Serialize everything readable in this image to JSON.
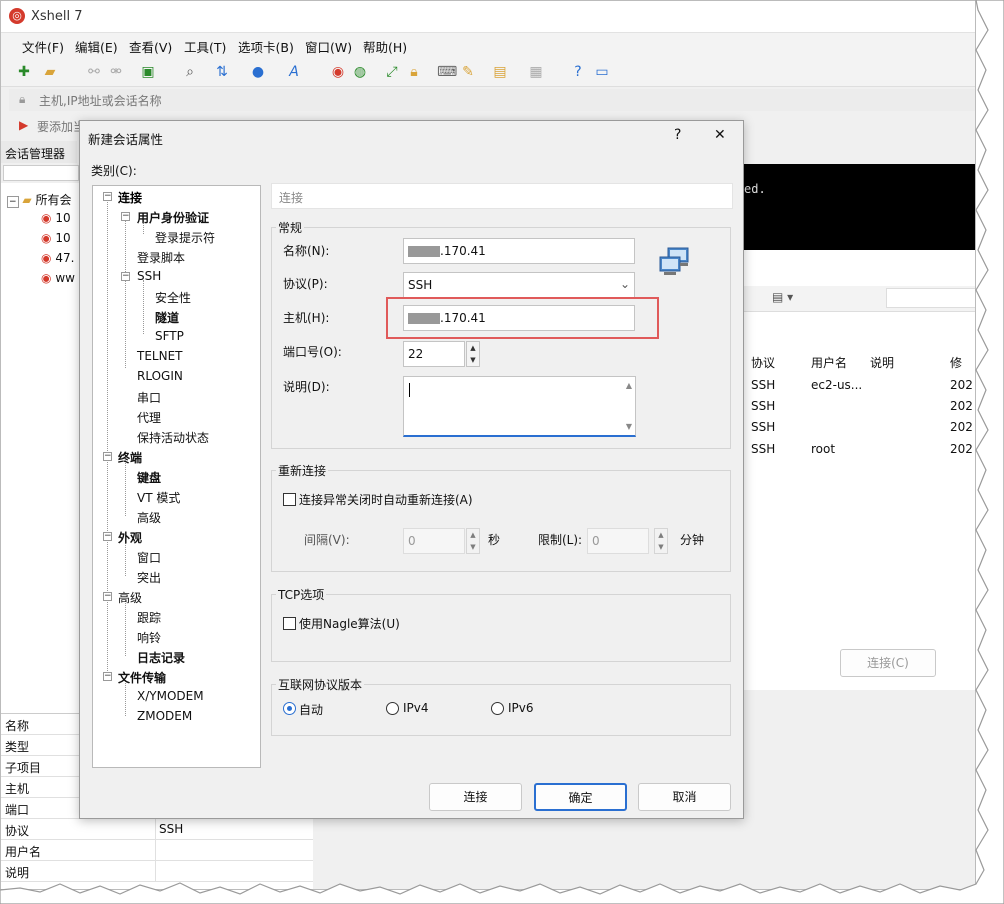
{
  "window": {
    "title": "Xshell 7",
    "brand_color": "#d43a2c"
  },
  "menu": [
    "文件(F)",
    "编辑(E)",
    "查看(V)",
    "工具(T)",
    "选项卡(B)",
    "窗口(W)",
    "帮助(H)"
  ],
  "address_bar": {
    "placeholder": "主机,IP地址或会话名称"
  },
  "notice": {
    "text": "要添加当"
  },
  "session_manager": {
    "title": "会话管理器",
    "root": "所有会",
    "items": [
      "10",
      "10",
      "47.",
      "ww"
    ]
  },
  "properties": {
    "rows": [
      {
        "key": "名称",
        "value": ""
      },
      {
        "key": "类型",
        "value": ""
      },
      {
        "key": "子项目",
        "value": ""
      },
      {
        "key": "主机",
        "value": ""
      },
      {
        "key": "端口",
        "value": ""
      },
      {
        "key": "协议",
        "value": "SSH"
      },
      {
        "key": "用户名",
        "value": ""
      },
      {
        "key": "说明",
        "value": ""
      }
    ]
  },
  "terminal": {
    "text": "ed."
  },
  "session_list": {
    "columns": [
      "协议",
      "用户名",
      "说明",
      "修"
    ],
    "rows": [
      {
        "protocol": "SSH",
        "user": "ec2-us...",
        "modified": "202"
      },
      {
        "protocol": "SSH",
        "user": "",
        "modified": "202"
      },
      {
        "protocol": "SSH",
        "user": "",
        "modified": "202"
      },
      {
        "protocol": "SSH",
        "user": "root",
        "modified": "202"
      }
    ],
    "connect_button": "连接(C)"
  },
  "dialog": {
    "title": "新建会话属性",
    "help": "?",
    "close": "✕",
    "category_label": "类别(C):",
    "tree": {
      "connection": "连接",
      "auth": "用户身份验证",
      "login_prompt": "登录提示符",
      "login_script": "登录脚本",
      "ssh": "SSH",
      "security": "安全性",
      "tunnel": "隧道",
      "sftp": "SFTP",
      "telnet": "TELNET",
      "rlogin": "RLOGIN",
      "serial": "串口",
      "proxy": "代理",
      "keepalive": "保持活动状态",
      "terminal": "终端",
      "keyboard": "键盘",
      "vt_mode": "VT 模式",
      "advanced": "高级",
      "appearance": "外观",
      "window": "窗口",
      "highlight": "突出",
      "advanced2": "高级",
      "trace": "跟踪",
      "bell": "响铃",
      "logging": "日志记录",
      "file_transfer": "文件传输",
      "xymodem": "X/YMODEM",
      "zmodem": "ZMODEM"
    },
    "section_header": "连接",
    "general": {
      "title": "常规",
      "name_label": "名称(N):",
      "name_value": ".170.41",
      "protocol_label": "协议(P):",
      "protocol_value": "SSH",
      "host_label": "主机(H):",
      "host_value": ".170.41",
      "port_label": "端口号(O):",
      "port_value": "22",
      "desc_label": "说明(D):",
      "desc_value": ""
    },
    "reconnect": {
      "title": "重新连接",
      "auto_label": "连接异常关闭时自动重新连接(A)",
      "auto_checked": false,
      "interval_label": "间隔(V):",
      "interval_value": "0",
      "interval_unit": "秒",
      "limit_label": "限制(L):",
      "limit_value": "0",
      "limit_unit": "分钟"
    },
    "tcp": {
      "title": "TCP选项",
      "nagle_label": "使用Nagle算法(U)",
      "nagle_checked": false
    },
    "ipver": {
      "title": "互联网协议版本",
      "options": [
        "自动",
        "IPv4",
        "IPv6"
      ],
      "selected": "自动"
    },
    "buttons": {
      "connect": "连接",
      "ok": "确定",
      "cancel": "取消"
    },
    "highlight_color": "#e05a5a",
    "accent_color": "#2a6fd1"
  }
}
